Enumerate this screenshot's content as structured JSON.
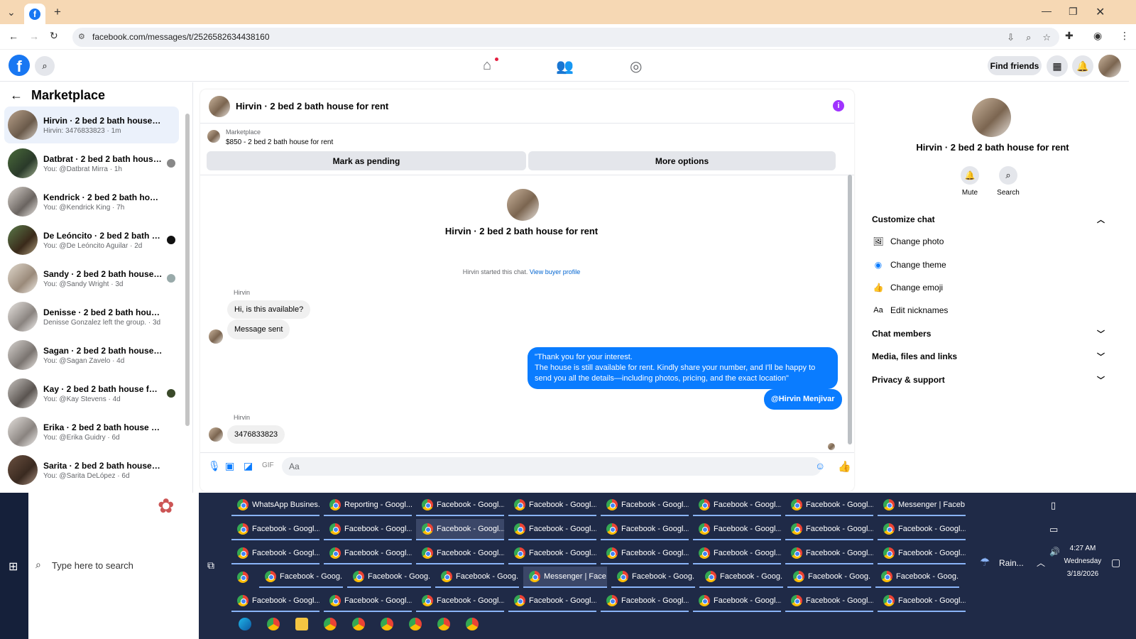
{
  "browser": {
    "url": "facebook.com/messages/t/2526582634438160"
  },
  "header": {
    "find_friends": "Find friends"
  },
  "left_panel": {
    "title": "Marketplace",
    "conversations": [
      {
        "title": "Hirvin · 2 bed 2 bath house for r...",
        "subtitle": "Hirvin: 3476833823 · 1m"
      },
      {
        "title": "Datbrat · 2 bed 2 bath house ...",
        "subtitle": "You: @Datbrat Mirra · 1h"
      },
      {
        "title": "Kendrick · 2 bed 2 bath house f...",
        "subtitle": "You: @Kendrick King · 7h"
      },
      {
        "title": "De Leóncito · 2 bed 2 bath ho...",
        "subtitle": "You: @De Leóncito Aguilar · 2d"
      },
      {
        "title": "Sandy · 2 bed 2 bath house fo...",
        "subtitle": "You: @Sandy Wright · 3d"
      },
      {
        "title": "Denisse · 2 bed 2 bath house for...",
        "subtitle": "Denisse Gonzalez left the group. · 3d"
      },
      {
        "title": "Sagan · 2 bed 2 bath house for r...",
        "subtitle": "You: @Sagan Zavelo · 4d"
      },
      {
        "title": "Kay · 2 bed 2 bath house for r...",
        "subtitle": "You: @Kay Stevens · 4d"
      },
      {
        "title": "Erika · 2 bed 2 bath house for rent",
        "subtitle": "You: @Erika Guidry · 6d"
      },
      {
        "title": "Sarita · 2 bed 2 bath house for r...",
        "subtitle": "You: @Sarita DeLópez · 6d"
      }
    ]
  },
  "chat": {
    "title": "Hirvin · 2 bed 2 bath house for rent",
    "listing_source": "Marketplace",
    "listing_detail": "$850 - 2 bed 2 bath house for rent",
    "mark_pending": "Mark as pending",
    "more_options": "More options",
    "center_name": "Hirvin · 2 bed 2 bath house for rent",
    "started_text": "Hirvin started this chat.",
    "view_buyer": "View buyer profile",
    "sender1": "Hirvin",
    "msg1": "Hi, is this available?",
    "msg2": "Message sent",
    "out_line1": "\"Thank you for your interest.",
    "out_line2": "The house is still available for rent. Kindly share your number, and I'll be happy to",
    "out_line3": "send you all the details—including photos, pricing, and the exact location\"",
    "mention": "@Hirvin Menjivar",
    "sender2": "Hirvin",
    "msg3": "3476833823",
    "composer_placeholder": "Aa"
  },
  "right_panel": {
    "name": "Hirvin · 2 bed 2 bath house for rent",
    "mute": "Mute",
    "search": "Search",
    "customize": "Customize chat",
    "change_photo": "Change photo",
    "change_theme": "Change theme",
    "change_emoji": "Change emoji",
    "edit_nicknames": "Edit nicknames",
    "chat_members": "Chat members",
    "media": "Media, files and links",
    "privacy": "Privacy & support"
  },
  "taskbar": {
    "search_placeholder": "Type here to search",
    "row1": [
      "WhatsApp Busines...",
      "Reporting - Googl...",
      "Facebook - Googl...",
      "Facebook - Googl...",
      "Facebook - Googl...",
      "Facebook - Googl...",
      "Facebook - Googl...",
      "Messenger | Faceb..."
    ],
    "row2": [
      "Facebook - Googl...",
      "Facebook - Googl...",
      "Facebook - Googl...",
      "Facebook - Googl...",
      "Facebook - Googl...",
      "Facebook - Googl...",
      "Facebook - Googl...",
      "Facebook - Googl..."
    ],
    "row3": [
      "Facebook - Googl...",
      "Facebook - Googl...",
      "Facebook - Googl...",
      "Facebook - Googl...",
      "Facebook - Googl...",
      "Facebook - Googl...",
      "Facebook - Googl...",
      "Facebook - Googl..."
    ],
    "row4": [
      "Facebook - Goog...",
      "Facebook - Goog...",
      "Facebook - Goog...",
      "Messenger | Face...",
      "Facebook - Goog...",
      "Facebook - Goog...",
      "Facebook - Goog...",
      "Facebook - Goog..."
    ],
    "row5": [
      "Facebook - Googl...",
      "Facebook - Googl...",
      "Facebook - Googl...",
      "Facebook - Googl...",
      "Facebook - Googl...",
      "Facebook - Googl...",
      "Facebook - Googl...",
      "Facebook - Googl..."
    ],
    "weather": "Rain...",
    "time": "4:27 AM",
    "day": "Wednesday",
    "date": "3/18/2026"
  }
}
